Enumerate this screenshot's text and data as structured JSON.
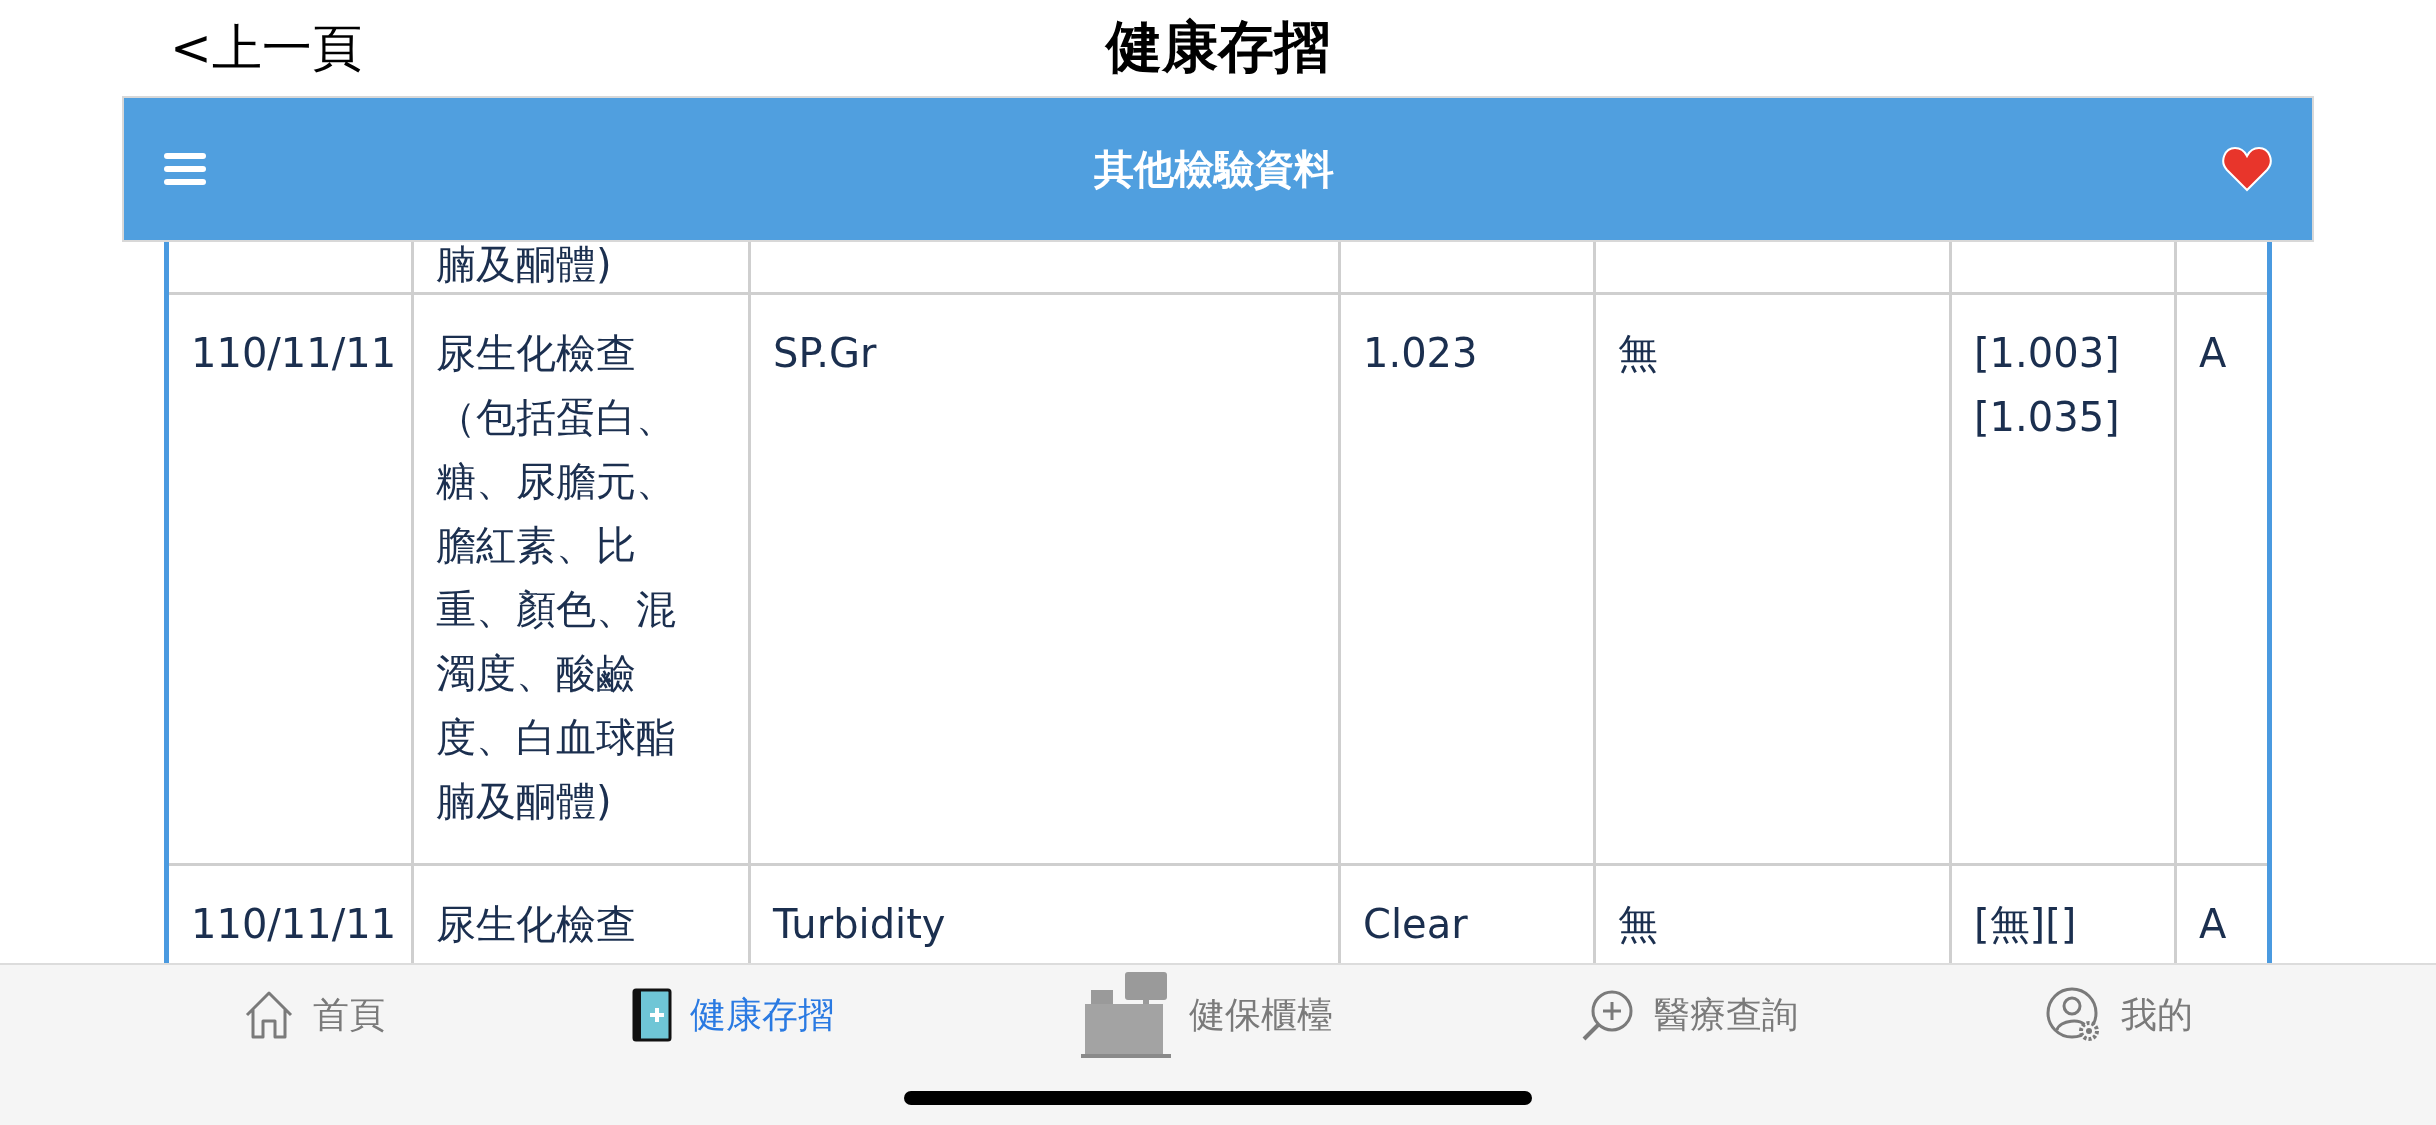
{
  "top_bar": {
    "back": "<上一頁",
    "title": "健康存摺"
  },
  "header": {
    "title": "其他檢驗資料",
    "favorite": true
  },
  "table": {
    "rows": [
      {
        "category": "腩及酮體)"
      },
      {
        "date": "110/11/11",
        "category": "尿生化檢查（包括蛋白、糖、尿膽元、膽紅素、比重、顏色、混濁度、酸鹼度、白血球酯腩及酮體)",
        "item": "SP.Gr",
        "value": "1.023",
        "column_5": "無",
        "range": [
          "[1.003]",
          "[1.035]"
        ],
        "column_7": "A"
      },
      {
        "date": "110/11/11",
        "category": "尿生化檢查",
        "item": "Turbidity",
        "value": "Clear",
        "column_5": "無",
        "range": [
          "[無][]"
        ],
        "column_7": "A"
      }
    ]
  },
  "tab_bar": [
    {
      "label": "首頁",
      "selected": false
    },
    {
      "label": "健康存摺",
      "selected": true
    },
    {
      "label": "健保櫃檯",
      "selected": false
    },
    {
      "label": "醫療查詢",
      "selected": false
    },
    {
      "label": "我的",
      "selected": false
    }
  ]
}
